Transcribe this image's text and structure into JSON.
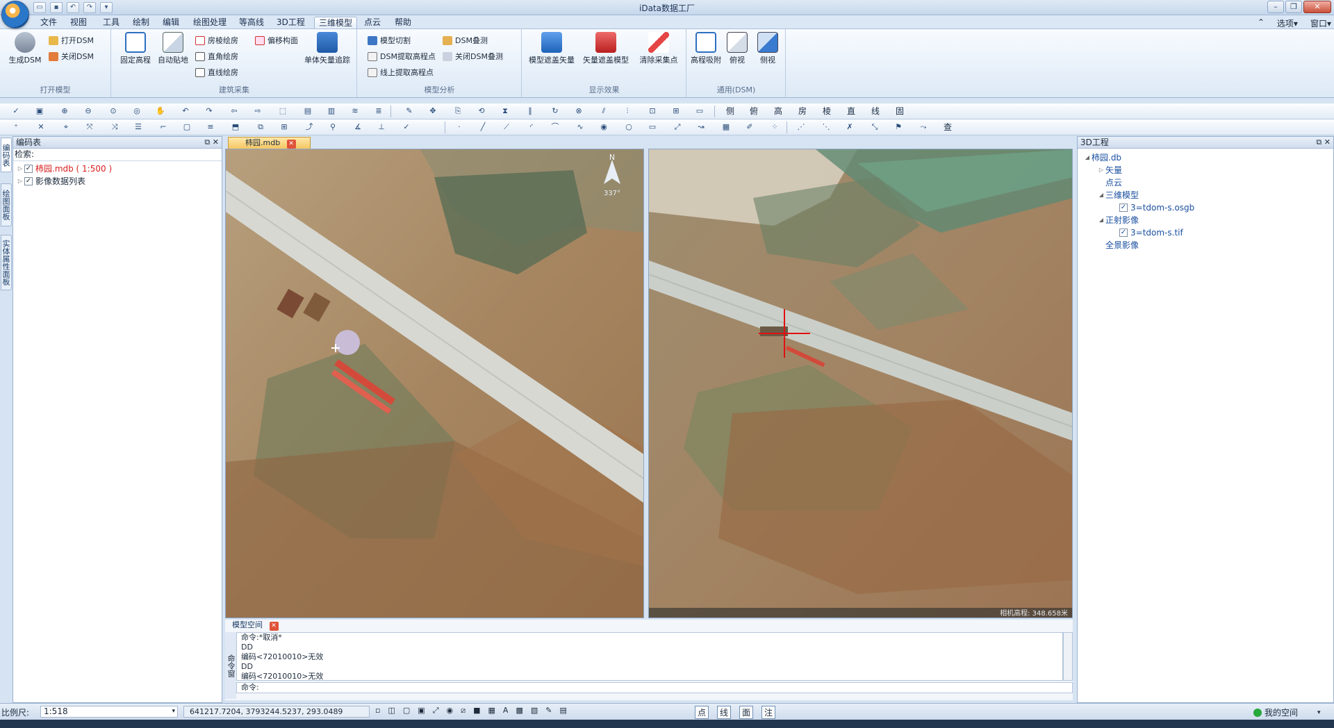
{
  "window": {
    "title": "iData数据工厂"
  },
  "menu": {
    "items": [
      "文件",
      "视图",
      "工具",
      "绘制",
      "编辑",
      "绘图处理",
      "等高线",
      "3D工程",
      "三维模型",
      "点云",
      "帮助"
    ],
    "active_index": 8,
    "options_label": "选项",
    "window_label": "窗口"
  },
  "ribbon": {
    "groups": [
      {
        "label": "打开模型",
        "big": [
          "生成DSM"
        ],
        "small": [
          "打开DSM",
          "关闭DSM"
        ]
      },
      {
        "label": "建筑采集",
        "big": [
          "固定高程",
          "自动贴地",
          "单体矢量追踪"
        ],
        "small": [
          "房棱绘房",
          "直角绘房",
          "直线绘房",
          "偏移构面"
        ]
      },
      {
        "label": "模型分析",
        "small": [
          "模型切割",
          "DSM提取高程点",
          "线上提取高程点",
          "DSM叠测",
          "关闭DSM叠测"
        ]
      },
      {
        "label": "显示效果",
        "big": [
          "模型遮盖矢量",
          "矢量遮盖模型",
          "清除采集点"
        ]
      },
      {
        "label": "通用(DSM)",
        "big": [
          "高程吸附",
          "俯视",
          "侧视"
        ]
      }
    ]
  },
  "toolbar1": {
    "text_buttons": [
      "侧",
      "俯",
      "高",
      "房",
      "棱",
      "直",
      "线",
      "固"
    ]
  },
  "toolbar2": {
    "text_buttons": [
      "查"
    ]
  },
  "left_panel": {
    "title": "编码表",
    "search_label": "检索:",
    "vertical_tabs": [
      "编码表",
      "绘图面板",
      "实体属性面板"
    ],
    "tree": [
      {
        "label": "柿园.mdb ( 1:500 )",
        "checked": true,
        "highlight": true
      },
      {
        "label": "影像数据列表",
        "checked": true,
        "highlight": false
      }
    ]
  },
  "document": {
    "tab_label": "柿园.mdb",
    "compass_label": "N",
    "compass_heading": "337°",
    "camera_height": "相机高程: 348.658米"
  },
  "command": {
    "tab_label": "模型空间",
    "side_label": "命令窗",
    "log": [
      "命令:*取消*",
      "DD",
      "编码<72010010>无效",
      "DD",
      "编码<72010010>无效"
    ],
    "input_label": "命令:"
  },
  "right_panel": {
    "title": "3D工程",
    "tree": [
      {
        "label": "柿园.db",
        "level": 0,
        "expander": "◢",
        "checkbox": false
      },
      {
        "label": "矢量",
        "level": 1,
        "expander": "▷",
        "checkbox": false
      },
      {
        "label": "点云",
        "level": 1,
        "expander": "",
        "checkbox": false
      },
      {
        "label": "三维模型",
        "level": 1,
        "expander": "◢",
        "checkbox": false
      },
      {
        "label": "3=tdom-s.osgb",
        "level": 2,
        "expander": "",
        "checkbox": true
      },
      {
        "label": "正射影像",
        "level": 1,
        "expander": "◢",
        "checkbox": false
      },
      {
        "label": "3=tdom-s.tif",
        "level": 2,
        "expander": "",
        "checkbox": true
      },
      {
        "label": "全景影像",
        "level": 1,
        "expander": "",
        "checkbox": false
      }
    ]
  },
  "status": {
    "scale_label": "比例尺:",
    "scale_value": "1:518",
    "coords": "641217.7204,  3793244.5237,  293.0489",
    "mode_buttons": [
      "点",
      "线",
      "面",
      "注"
    ],
    "workspace": "我的空间"
  },
  "colors": {
    "accent": "#3b6fb0",
    "highlight_text": "#d81e1e",
    "link_text": "#1b4fa0",
    "crosshair": "#e01010"
  }
}
